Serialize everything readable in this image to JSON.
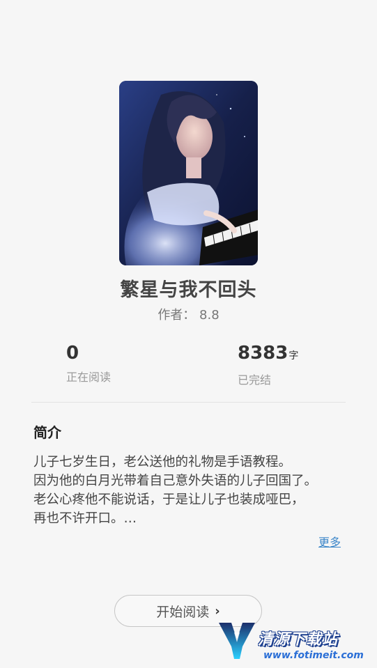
{
  "book": {
    "title": "繁星与我不回头",
    "author_line": "作者： 8.8"
  },
  "stats": {
    "reading_count": "0",
    "reading_label": "正在阅读",
    "word_count": "8383",
    "word_unit": "字",
    "status_label": "已完结"
  },
  "intro": {
    "heading": "简介",
    "text": "儿子七岁生日，老公送他的礼物是手语教程。\n因为他的白月光带着自己意外失语的儿子回国了。\n老公心疼他不能说话，于是让儿子也装成哑巴，\n再也不许开口。…",
    "more_label": "更多"
  },
  "actions": {
    "start_reading_label": "开始阅读"
  },
  "watermark": {
    "name": "清源下载站",
    "url": "www.fotimeit.com"
  },
  "icons": {
    "start_chevron": "chevron-right-icon",
    "cover": "book-cover-image"
  },
  "colors": {
    "background": "#f6f6f6",
    "link": "#3d87c9"
  }
}
